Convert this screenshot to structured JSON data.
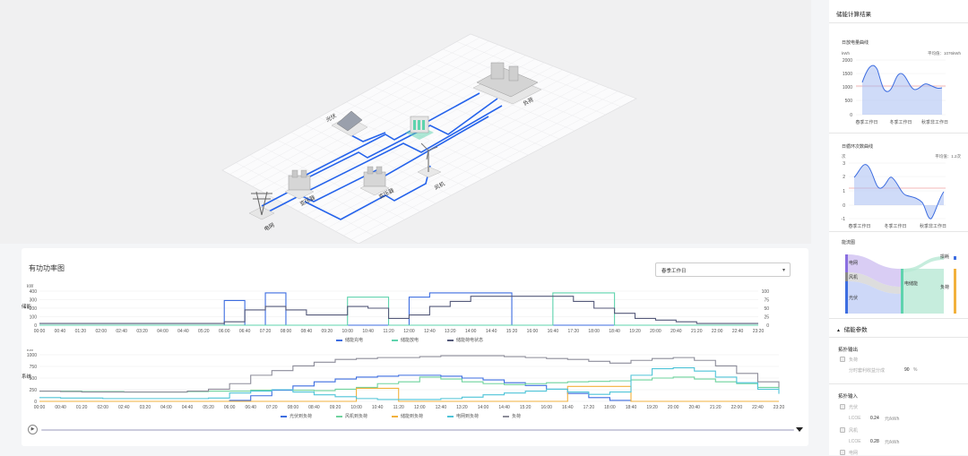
{
  "scene": {
    "labels": {
      "pv": "光伏",
      "storage": "储能",
      "load": "负荷",
      "grid": "电网",
      "transformer1": "变压器",
      "transformer2": "变压器",
      "wind": "风机"
    }
  },
  "main_card": {
    "title": "有功功率图",
    "select_value": "春季工作日"
  },
  "right_panel": {
    "title": "储能计算结果",
    "daily_discharge": {
      "title": "日放电量曲线",
      "unit": "kWh",
      "avg_label": "平均值：1076kWh",
      "y_ticks": [
        "2000",
        "1500",
        "1000",
        "500",
        "0"
      ],
      "categories": [
        "春季工作日",
        "冬季工作日",
        "秋季非工作日"
      ]
    },
    "daily_cycles": {
      "title": "日循环次数曲线",
      "unit": "次",
      "avg_label": "平均值：1.2次",
      "y_ticks": [
        "3",
        "2",
        "1",
        "0",
        "-1"
      ],
      "categories": [
        "春季工作日",
        "冬季工作日",
        "秋季非工作日"
      ]
    },
    "sankey": {
      "title": "能流图",
      "nodes": [
        "电网",
        "风机",
        "光伏",
        "电储能",
        "负荷",
        "损耗"
      ]
    },
    "params": {
      "title": "储能参数",
      "output_title": "拓扑输出",
      "output_item": "负荷",
      "output_rate_label": "分时套利收益分成",
      "output_rate_value": "90",
      "output_rate_unit": "%",
      "input_title": "拓扑输入",
      "inputs": [
        {
          "name": "光伏",
          "lcoe_label": "LCOE",
          "lcoe_value": "0.24",
          "unit": "元/kWh"
        },
        {
          "name": "风机",
          "lcoe_label": "LCOE",
          "lcoe_value": "0.28",
          "unit": "元/kWh"
        },
        {
          "name": "电网"
        }
      ]
    }
  },
  "chart_data": [
    {
      "type": "line",
      "title": "",
      "ylabel": "储能",
      "unit": "kW",
      "ylim": [
        0,
        400
      ],
      "y2lim": [
        0,
        100
      ],
      "y_ticks": [
        "400",
        "300",
        "200",
        "100",
        "0"
      ],
      "y2_ticks": [
        "100",
        "75",
        "50",
        "25",
        "0"
      ],
      "x": [
        "00:00",
        "00:40",
        "01:20",
        "02:00",
        "02:40",
        "03:20",
        "04:00",
        "04:40",
        "05:20",
        "06:00",
        "06:40",
        "07:20",
        "08:00",
        "08:40",
        "09:20",
        "10:00",
        "10:40",
        "11:20",
        "12:00",
        "12:40",
        "13:20",
        "14:00",
        "14:40",
        "15:20",
        "16:00",
        "16:40",
        "17:20",
        "18:00",
        "18:40",
        "19:20",
        "20:00",
        "20:40",
        "21:20",
        "22:00",
        "22:40",
        "23:20"
      ],
      "series": [
        {
          "name": "储能充电",
          "color": "#3d6de0",
          "values": [
            0,
            0,
            0,
            0,
            0,
            0,
            0,
            0,
            0,
            290,
            0,
            380,
            0,
            0,
            0,
            0,
            0,
            0,
            330,
            380,
            380,
            380,
            380,
            0,
            0,
            0,
            0,
            0,
            0,
            0,
            0,
            0,
            0,
            0,
            0,
            0
          ]
        },
        {
          "name": "储能放电",
          "color": "#5ed3ad",
          "values": [
            0,
            0,
            0,
            0,
            0,
            0,
            0,
            0,
            0,
            0,
            0,
            0,
            0,
            0,
            0,
            330,
            330,
            0,
            0,
            0,
            0,
            0,
            0,
            0,
            0,
            380,
            380,
            380,
            0,
            0,
            0,
            0,
            0,
            0,
            0,
            0
          ]
        },
        {
          "name": "储能荷电状态",
          "color": "#555a7a",
          "values": [
            5,
            5,
            5,
            5,
            5,
            5,
            5,
            5,
            5,
            10,
            45,
            55,
            45,
            30,
            30,
            55,
            50,
            20,
            30,
            55,
            70,
            85,
            85,
            85,
            85,
            85,
            70,
            50,
            35,
            20,
            15,
            10,
            5,
            5,
            5,
            5
          ]
        }
      ]
    },
    {
      "type": "line",
      "title": "",
      "ylabel": "系统",
      "unit": "kW",
      "ylim": [
        0,
        1000
      ],
      "y_ticks": [
        "1000",
        "750",
        "500",
        "250",
        "0"
      ],
      "x": [
        "00:00",
        "00:40",
        "01:20",
        "02:00",
        "02:40",
        "03:20",
        "04:00",
        "04:40",
        "05:20",
        "06:00",
        "06:40",
        "07:20",
        "08:00",
        "08:40",
        "09:20",
        "10:00",
        "10:40",
        "11:20",
        "12:00",
        "12:40",
        "13:20",
        "14:00",
        "14:40",
        "15:20",
        "16:00",
        "16:40",
        "17:20",
        "18:00",
        "18:40",
        "19:20",
        "20:00",
        "20:40",
        "21:20",
        "22:00",
        "22:40",
        "23:20"
      ],
      "series": [
        {
          "name": "光伏到负荷",
          "color": "#3d6de0",
          "values": [
            0,
            0,
            0,
            0,
            0,
            0,
            0,
            0,
            0,
            20,
            120,
            240,
            330,
            420,
            480,
            520,
            540,
            560,
            560,
            540,
            500,
            460,
            400,
            340,
            260,
            170,
            80,
            20,
            0,
            0,
            0,
            0,
            0,
            0,
            0,
            0
          ]
        },
        {
          "name": "风机到负荷",
          "color": "#6fd39e",
          "values": [
            220,
            220,
            210,
            210,
            200,
            200,
            200,
            210,
            220,
            220,
            240,
            250,
            240,
            230,
            260,
            300,
            380,
            420,
            520,
            480,
            420,
            380,
            360,
            380,
            400,
            420,
            430,
            440,
            460,
            500,
            520,
            480,
            420,
            380,
            300,
            260
          ]
        },
        {
          "name": "储能到负荷",
          "color": "#f2b13c",
          "values": [
            0,
            0,
            0,
            0,
            0,
            0,
            0,
            0,
            0,
            0,
            0,
            0,
            0,
            0,
            0,
            280,
            280,
            0,
            0,
            0,
            0,
            0,
            0,
            0,
            0,
            320,
            320,
            320,
            0,
            0,
            0,
            0,
            0,
            0,
            0,
            0
          ]
        },
        {
          "name": "电网到负荷",
          "color": "#4fc4d8",
          "values": [
            80,
            70,
            70,
            60,
            60,
            60,
            60,
            60,
            70,
            180,
            220,
            250,
            200,
            140,
            100,
            60,
            40,
            40,
            40,
            60,
            90,
            140,
            180,
            220,
            260,
            200,
            150,
            200,
            560,
            700,
            720,
            650,
            520,
            400,
            260,
            160
          ]
        },
        {
          "name": "负荷",
          "color": "#8c8c99",
          "values": [
            220,
            210,
            200,
            200,
            200,
            200,
            200,
            220,
            260,
            380,
            560,
            660,
            760,
            840,
            900,
            920,
            940,
            940,
            960,
            980,
            980,
            980,
            960,
            940,
            920,
            900,
            860,
            820,
            880,
            920,
            940,
            880,
            760,
            600,
            420,
            300
          ]
        }
      ]
    }
  ]
}
